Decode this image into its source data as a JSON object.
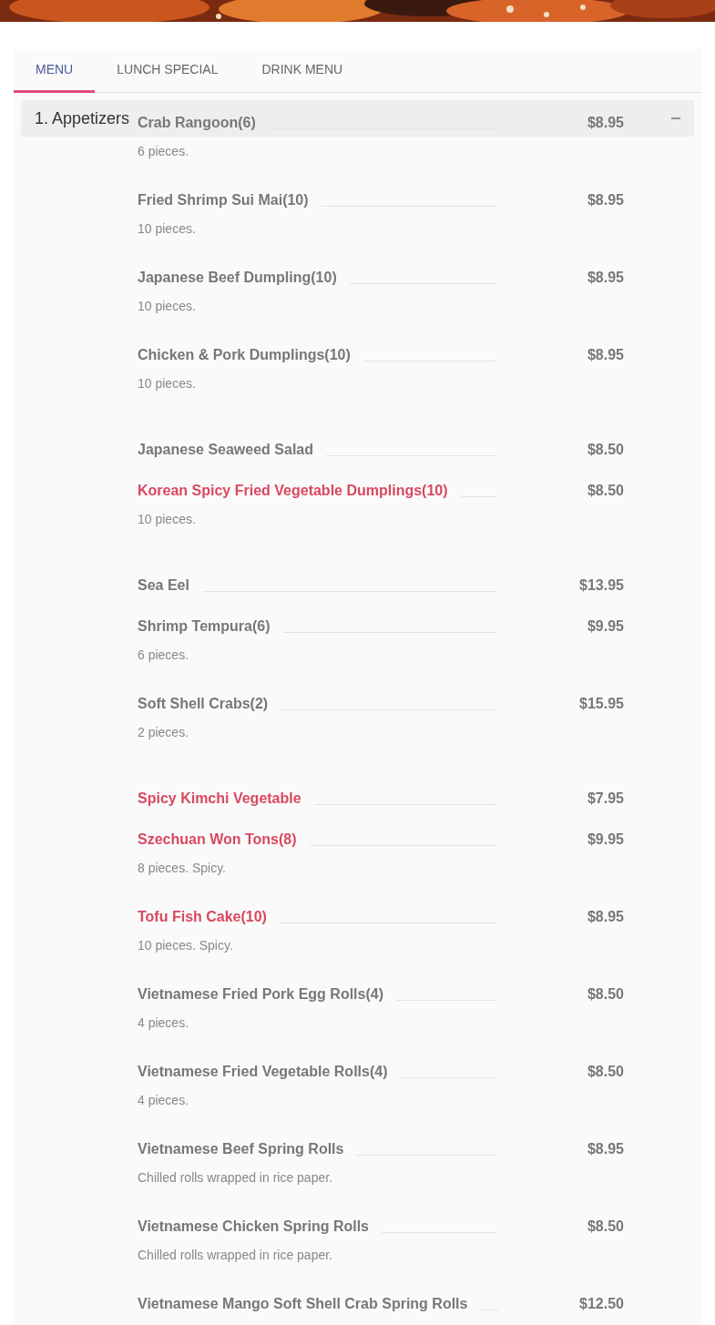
{
  "tabs": [
    {
      "label": "MENU",
      "selected": true
    },
    {
      "label": "LUNCH SPECIAL",
      "selected": false
    },
    {
      "label": "DRINK MENU",
      "selected": false
    }
  ],
  "section": {
    "title": "1. Appetizers",
    "expanded": true
  },
  "items": [
    {
      "name": "Crab Rangoon(6)",
      "price": "$8.95",
      "description": "6 pieces.",
      "spicy": false
    },
    {
      "name": "Fried Shrimp Sui Mai(10)",
      "price": "$8.95",
      "description": "10 pieces.",
      "spicy": false
    },
    {
      "name": "Japanese Beef Dumpling(10)",
      "price": "$8.95",
      "description": "10 pieces.",
      "spicy": false
    },
    {
      "name": "Chicken & Pork Dumplings(10)",
      "price": "$8.95",
      "description": "10 pieces.",
      "spicy": false
    },
    {
      "name": "Japanese Seaweed Salad",
      "price": "$8.50",
      "spicy": false
    },
    {
      "name": "Korean Spicy Fried Vegetable Dumplings(10)",
      "price": "$8.50",
      "description": "10 pieces.",
      "spicy": true
    },
    {
      "name": "Sea Eel",
      "price": "$13.95",
      "spicy": false
    },
    {
      "name": "Shrimp Tempura(6)",
      "price": "$9.95",
      "description": "6 pieces.",
      "spicy": false
    },
    {
      "name": "Soft Shell Crabs(2)",
      "price": "$15.95",
      "description": "2 pieces.",
      "spicy": false
    },
    {
      "name": "Spicy Kimchi Vegetable",
      "price": "$7.95",
      "spicy": true
    },
    {
      "name": "Szechuan Won Tons(8)",
      "price": "$9.95",
      "description": "8 pieces. Spicy.",
      "spicy": true
    },
    {
      "name": "Tofu Fish Cake(10)",
      "price": "$8.95",
      "description": "10 pieces. Spicy.",
      "spicy": true
    },
    {
      "name": "Vietnamese Fried Pork Egg Rolls(4)",
      "price": "$8.50",
      "description": "4 pieces.",
      "spicy": false
    },
    {
      "name": "Vietnamese Fried Vegetable Rolls(4)",
      "price": "$8.50",
      "description": "4 pieces.",
      "spicy": false
    },
    {
      "name": "Vietnamese Beef Spring Rolls",
      "price": "$8.95",
      "description": "Chilled rolls wrapped in rice paper.",
      "spicy": false
    },
    {
      "name": "Vietnamese Chicken Spring Rolls",
      "price": "$8.50",
      "description": "Chilled rolls wrapped in rice paper.",
      "spicy": false
    },
    {
      "name": "Vietnamese Mango Soft Shell Crab Spring Rolls",
      "price": "$12.50",
      "spicy": false
    }
  ]
}
